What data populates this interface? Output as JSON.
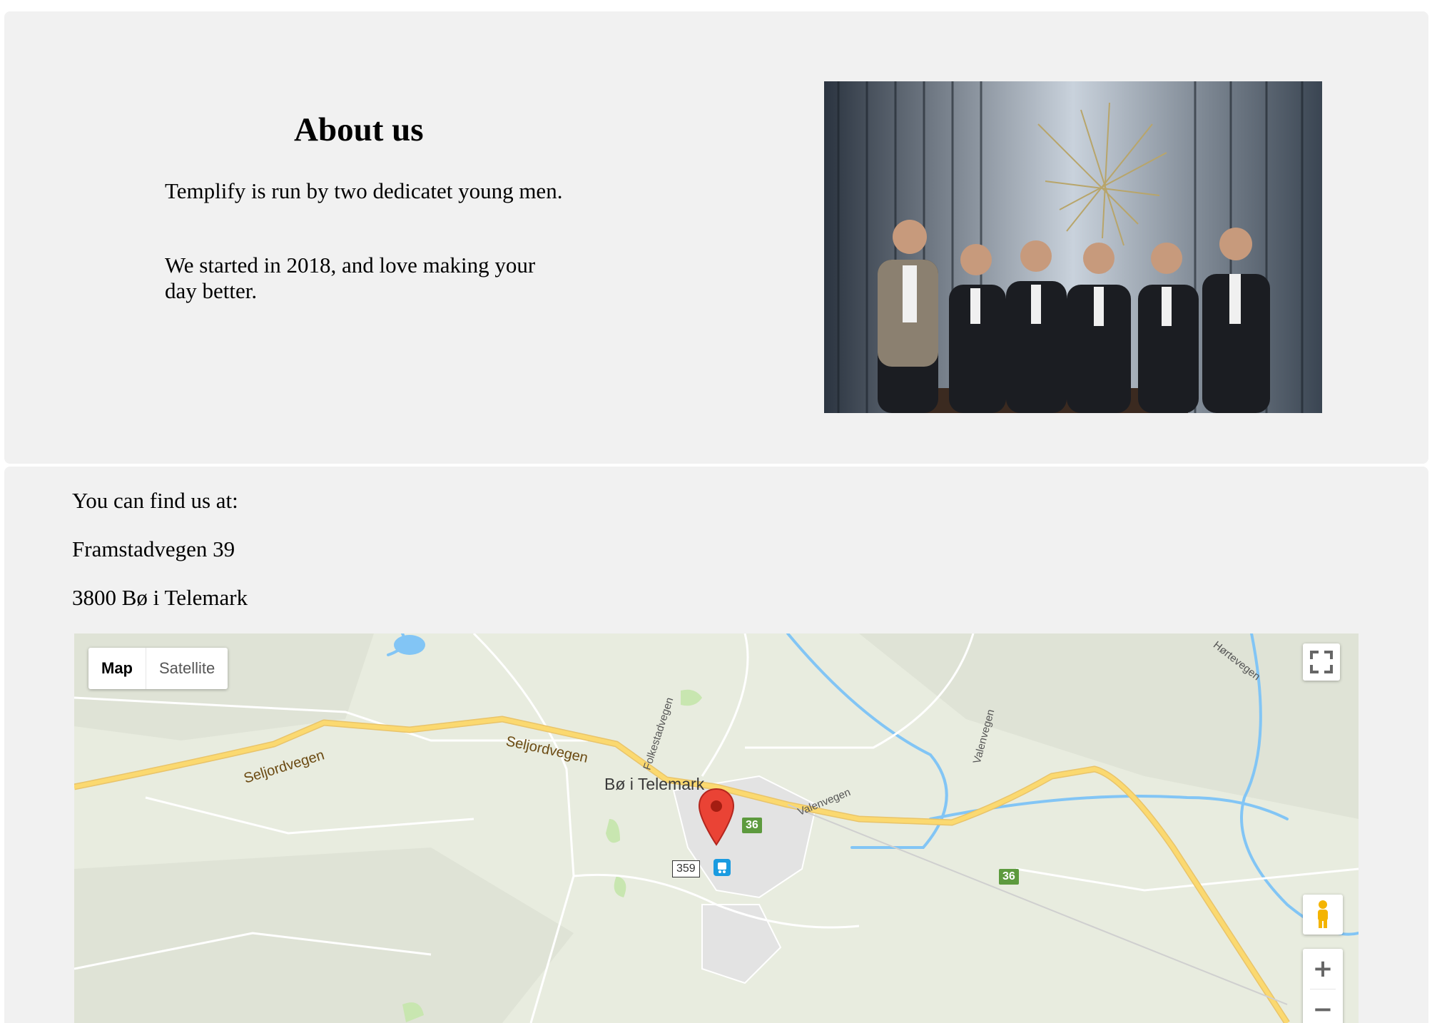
{
  "about": {
    "title": "About us",
    "paragraph1": "Templify is run by two dedicatet young men.",
    "paragraph2": "We started in 2018, and love making your day better."
  },
  "location": {
    "intro": "You can find us at:",
    "street": "Framstadvegen 39",
    "city": "3800 Bø i Telemark"
  },
  "map": {
    "type_controls": {
      "map": "Map",
      "satellite": "Satellite",
      "selected": "Map"
    },
    "labels": {
      "town": "Bø i Telemark",
      "seljordvegen_west": "Seljordvegen",
      "seljordvegen_east": "Seljordvegen",
      "folkestadvegen": "Folkestadvegen",
      "valenvegen_1": "Valenvegen",
      "valenvegen_2": "Valenvegen",
      "hortevegen": "Hørtevegen"
    },
    "shields": {
      "route_36_a": "36",
      "route_36_b": "36",
      "route_359": "359"
    },
    "zoom_in": "+",
    "zoom_out": "−",
    "colors": {
      "road_major": "#fbd970",
      "water": "#82c5f5",
      "land": "#e8ecdf",
      "park": "#c8e6b0",
      "marker": "#ea4335"
    },
    "icons": [
      "fullscreen-icon",
      "pegman-icon",
      "location-marker-icon",
      "bus-stop-icon"
    ]
  }
}
